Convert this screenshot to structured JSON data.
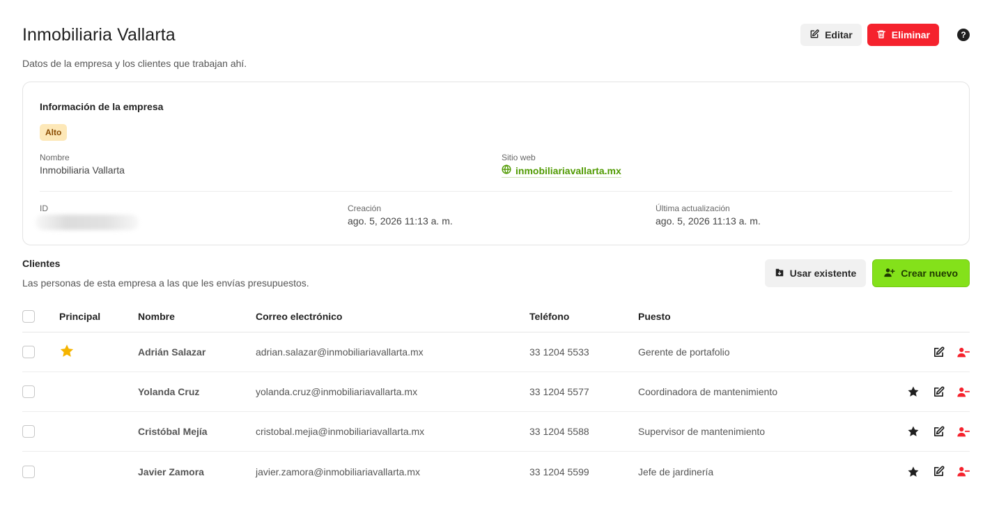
{
  "header": {
    "title": "Inmobiliaria Vallarta",
    "subtitle": "Datos de la empresa y los clientes que trabajan ahí.",
    "edit_label": "Editar",
    "delete_label": "Eliminar",
    "help_glyph": "?"
  },
  "company": {
    "card_title": "Información de la empresa",
    "priority_badge": "Alto",
    "name_label": "Nombre",
    "name_value": "Inmobiliaria Vallarta",
    "website_label": "Sitio web",
    "website_value": "inmobiliariavallarta.mx",
    "id_label": "ID",
    "id_value": "",
    "created_label": "Creación",
    "created_value": "ago. 5, 2026 11:13 a. m.",
    "updated_label": "Última actualización",
    "updated_value": "ago. 5, 2026 11:13 a. m."
  },
  "clients": {
    "title": "Clientes",
    "subtitle": "Las personas de esta empresa a las que les envías presupuestos.",
    "use_existing_label": "Usar existente",
    "create_new_label": "Crear nuevo",
    "columns": {
      "principal": "Principal",
      "name": "Nombre",
      "email": "Correo electrónico",
      "phone": "Teléfono",
      "position": "Puesto"
    },
    "rows": [
      {
        "name": "Adrián Salazar",
        "email": "adrian.salazar@inmobiliariavallarta.mx",
        "phone": "33 1204 5533",
        "position": "Gerente de portafolio",
        "principal": true
      },
      {
        "name": "Yolanda Cruz",
        "email": "yolanda.cruz@inmobiliariavallarta.mx",
        "phone": "33 1204 5577",
        "position": "Coordinadora de mantenimiento",
        "principal": false
      },
      {
        "name": "Cristóbal Mejía",
        "email": "cristobal.mejia@inmobiliariavallarta.mx",
        "phone": "33 1204 5588",
        "position": "Supervisor de mantenimiento",
        "principal": false
      },
      {
        "name": "Javier Zamora",
        "email": "javier.zamora@inmobiliariavallarta.mx",
        "phone": "33 1204 5599",
        "position": "Jefe de jardinería",
        "principal": false
      }
    ]
  },
  "colors": {
    "accent_green": "#84e11a",
    "danger_red": "#f5222d",
    "star_gold": "#f5b400",
    "badge_bg": "#fde8b8",
    "link_green": "#4f9a00"
  },
  "icons": {
    "edit": "edit-icon",
    "delete": "trash-icon",
    "help": "help-icon",
    "globe": "globe-icon",
    "import": "import-icon",
    "add_user": "add-user-icon",
    "star": "star-icon",
    "remove_user": "remove-user-icon"
  }
}
